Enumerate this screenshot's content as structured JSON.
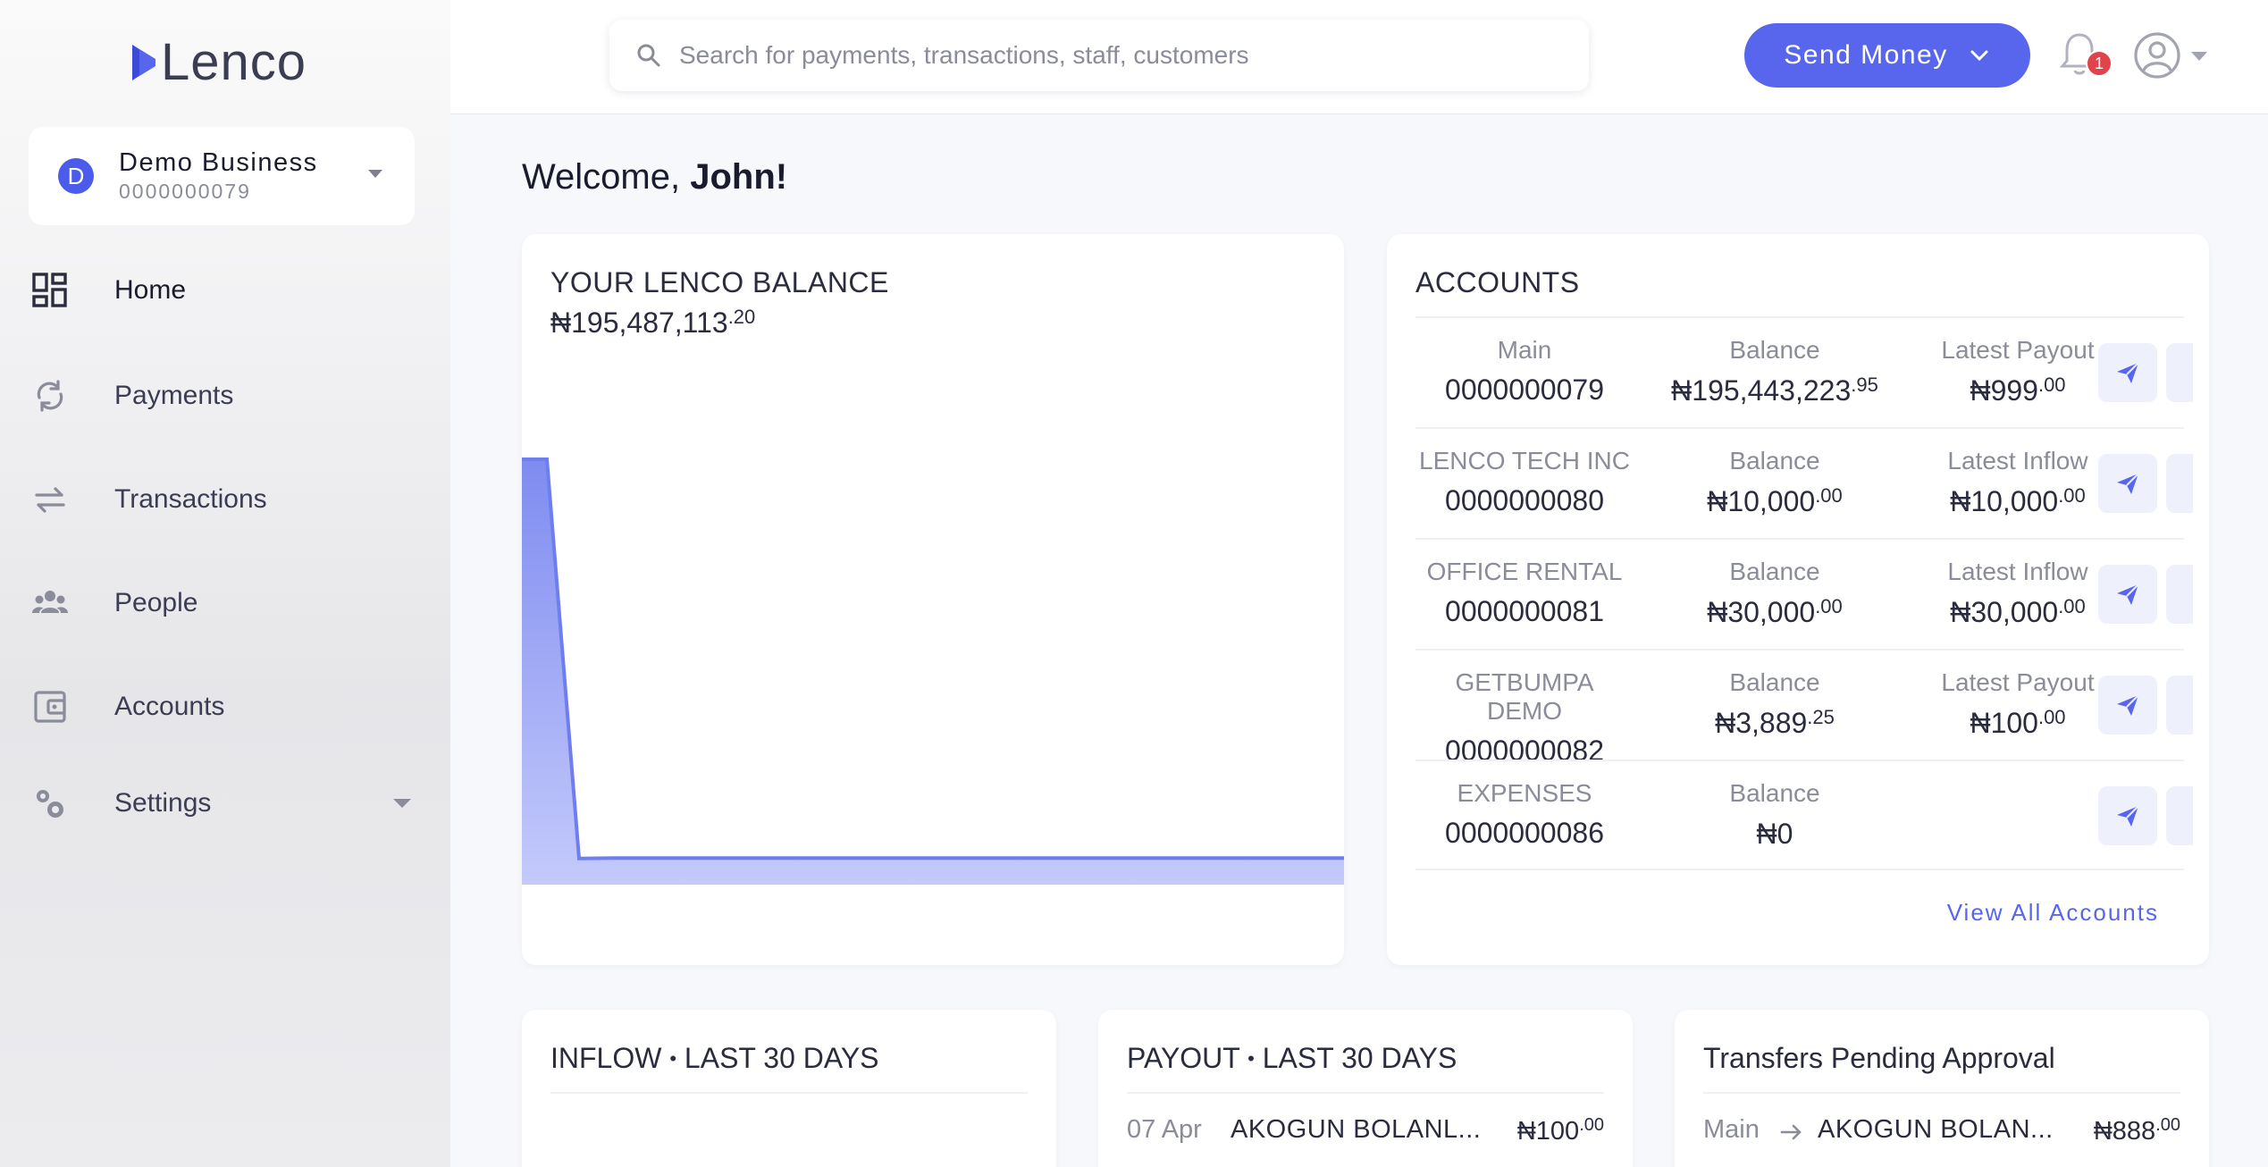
{
  "app": {
    "logo_text": "Lenco"
  },
  "business": {
    "avatar_letter": "D",
    "name": "Demo Business",
    "number": "0000000079"
  },
  "sidebar": {
    "items": [
      {
        "label": "Home",
        "icon": "dashboard-icon"
      },
      {
        "label": "Payments",
        "icon": "refresh-icon"
      },
      {
        "label": "Transactions",
        "icon": "swap-arrows-icon"
      },
      {
        "label": "People",
        "icon": "people-icon"
      },
      {
        "label": "Accounts",
        "icon": "wallet-icon"
      },
      {
        "label": "Settings",
        "icon": "gears-icon"
      }
    ]
  },
  "topbar": {
    "search_placeholder": "Search for payments, transactions, staff, customers",
    "send_money_label": "Send Money",
    "notification_count": "1"
  },
  "welcome": {
    "prefix": "Welcome, ",
    "name": "John!"
  },
  "balance": {
    "title": "YOUR LENCO BALANCE",
    "currency": "₦",
    "whole": "195,487,113",
    "fraction": ".20"
  },
  "chart_data": {
    "type": "area",
    "series": [
      {
        "values": [
          195487113,
          195487113,
          4000000,
          4200000,
          4200000,
          4200000,
          4200000,
          4200000,
          4200000,
          4200000,
          4200000
        ]
      }
    ],
    "grid": false,
    "color": "#7f8cf0"
  },
  "accounts": {
    "title": "ACCOUNTS",
    "rows": [
      {
        "name": "Main",
        "number": "0000000079",
        "balance_label": "Balance",
        "balance": "₦195,443,223",
        "balance_frac": ".95",
        "latest_label": "Latest Payout",
        "latest": "₦999",
        "latest_frac": ".00"
      },
      {
        "name": "LENCO TECH INC",
        "number": "0000000080",
        "balance_label": "Balance",
        "balance": "₦10,000",
        "balance_frac": ".00",
        "latest_label": "Latest Inflow",
        "latest": "₦10,000",
        "latest_frac": ".00"
      },
      {
        "name": "OFFICE RENTAL",
        "number": "0000000081",
        "balance_label": "Balance",
        "balance": "₦30,000",
        "balance_frac": ".00",
        "latest_label": "Latest Inflow",
        "latest": "₦30,000",
        "latest_frac": ".00"
      },
      {
        "name": "GETBUMPA DEMO",
        "number": "0000000082",
        "balance_label": "Balance",
        "balance": "₦3,889",
        "balance_frac": ".25",
        "latest_label": "Latest Payout",
        "latest": "₦100",
        "latest_frac": ".00"
      },
      {
        "name": "EXPENSES",
        "number": "0000000086",
        "balance_label": "Balance",
        "balance": "₦0",
        "balance_frac": "",
        "latest_label": "",
        "latest": "",
        "latest_frac": ""
      }
    ],
    "view_all_label": "View All Accounts"
  },
  "inflow": {
    "title_a": "INFLOW",
    "dot": "•",
    "title_b": "LAST 30 DAYS"
  },
  "payout": {
    "title_a": "PAYOUT",
    "dot": "•",
    "title_b": "LAST 30 DAYS",
    "rows": [
      {
        "date": "07 Apr",
        "name": "AKOGUN BOLANL...",
        "amount": "₦100",
        "amount_frac": ".00"
      }
    ]
  },
  "pending": {
    "title": "Transfers Pending Approval",
    "rows": [
      {
        "from": "Main",
        "to": "AKOGUN BOLAN...",
        "amount": "₦888",
        "amount_frac": ".00"
      }
    ]
  }
}
